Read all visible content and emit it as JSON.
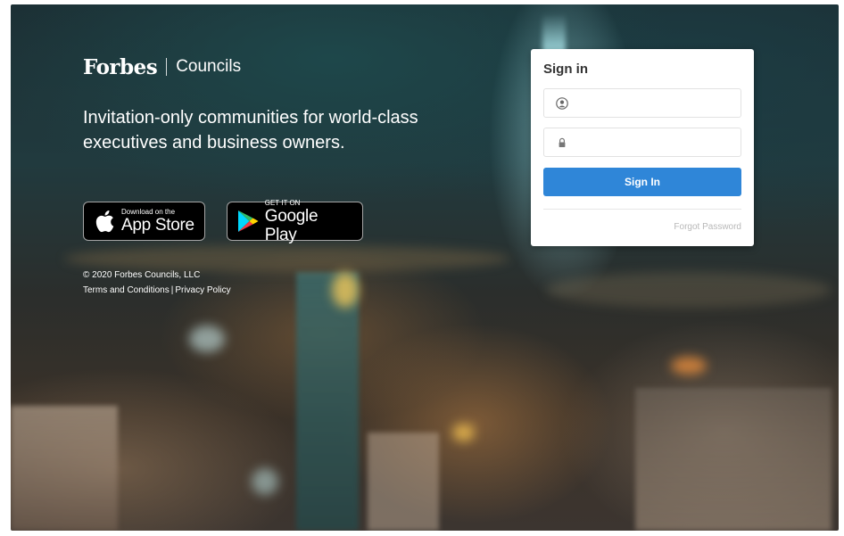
{
  "brand": {
    "name": "Forbes",
    "product": "Councils"
  },
  "tagline": "Invitation-only communities for world-class executives and business owners.",
  "stores": {
    "apple": {
      "small": "Download on the",
      "big": "App Store",
      "icon": "apple-icon"
    },
    "google": {
      "small": "GET IT ON",
      "big": "Google Play",
      "icon": "google-play-icon"
    }
  },
  "footer": {
    "copyright": "© 2020 Forbes Councils, LLC",
    "terms": "Terms and Conditions",
    "separator": "|",
    "privacy": "Privacy Policy"
  },
  "signin": {
    "title": "Sign in",
    "username_placeholder": "",
    "username_icon": "user-icon",
    "password_placeholder": "",
    "password_icon": "lock-icon",
    "button_label": "Sign In",
    "forgot_label": "Forgot Password"
  },
  "colors": {
    "accent": "#2f86d8",
    "background_dark": "#1c2f34"
  }
}
